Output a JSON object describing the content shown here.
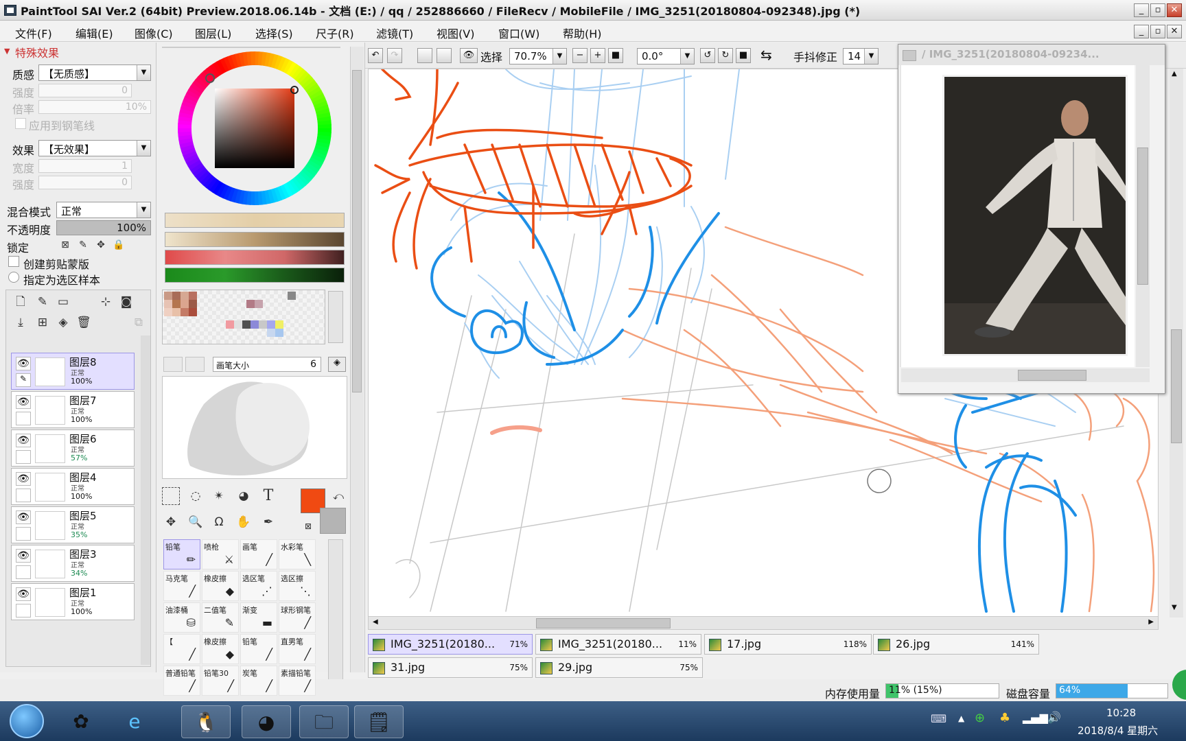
{
  "title": "PaintTool SAI Ver.2 (64bit) Preview.2018.06.14b - 文档 (E:) / qq / 252886660 / FileRecv / MobileFile / IMG_3251(20180804-092348).jpg (*)",
  "menu": [
    "文件(F)",
    "编辑(E)",
    "图像(C)",
    "图层(L)",
    "选择(S)",
    "尺子(R)",
    "滤镜(T)",
    "视图(V)",
    "窗口(W)",
    "帮助(H)"
  ],
  "special_effects": {
    "header": "特殊效果",
    "texture_label": "质感",
    "texture_value": "【无质感】",
    "strength_label": "强度",
    "strength_value": "0",
    "scale_label": "倍率",
    "scale_value": "10%",
    "apply_pen_label": "应用到钢笔线",
    "effect_label": "效果",
    "effect_value": "【无效果】",
    "width_label": "宽度",
    "width_value": "1",
    "strength2_label": "强度",
    "strength2_value": "0"
  },
  "layer_props": {
    "blend_label": "混合模式",
    "blend_value": "正常",
    "opacity_label": "不透明度",
    "opacity_value": "100%",
    "lock_label": "锁定",
    "clip_label": "创建剪贴蒙版",
    "sample_label": "指定为选区样本"
  },
  "layers": [
    {
      "name": "图层8",
      "mode": "正常",
      "opacity": "100%",
      "active": true
    },
    {
      "name": "图层7",
      "mode": "正常",
      "opacity": "100%",
      "active": false
    },
    {
      "name": "图层6",
      "mode": "正常",
      "opacity": "57%",
      "active": false
    },
    {
      "name": "图层4",
      "mode": "正常",
      "opacity": "100%",
      "active": false
    },
    {
      "name": "图层5",
      "mode": "正常",
      "opacity": "35%",
      "active": false
    },
    {
      "name": "图层3",
      "mode": "正常",
      "opacity": "34%",
      "active": false
    },
    {
      "name": "图层1",
      "mode": "正常",
      "opacity": "100%",
      "active": false
    }
  ],
  "brush": {
    "size_label": "画笔大小",
    "size_value": "6"
  },
  "colors": {
    "primary": "#f04a12",
    "secondary": "#b4b4b4",
    "accent": "#9c95e6"
  },
  "tools": [
    {
      "name": "铅笔",
      "icon": "pencil-icon",
      "active": true
    },
    {
      "name": "喷枪",
      "icon": "airbrush-icon",
      "active": false
    },
    {
      "name": "画笔",
      "icon": "brush-icon",
      "active": false
    },
    {
      "name": "水彩笔",
      "icon": "watercolor-icon",
      "active": false
    },
    {
      "name": "马克笔",
      "icon": "marker-icon",
      "active": false
    },
    {
      "name": "橡皮擦",
      "icon": "eraser-icon",
      "active": false
    },
    {
      "name": "选区笔",
      "icon": "selpen-icon",
      "active": false
    },
    {
      "name": "选区擦",
      "icon": "selerase-icon",
      "active": false
    },
    {
      "name": "油漆桶",
      "icon": "bucket-icon",
      "active": false
    },
    {
      "name": "二值笔",
      "icon": "binary-pen-icon",
      "active": false
    },
    {
      "name": "渐变",
      "icon": "gradient-icon",
      "active": false
    },
    {
      "name": "球形钢笔",
      "icon": "ball-pen-icon",
      "active": false
    },
    {
      "name": "【",
      "icon": "bracket-icon",
      "active": false
    },
    {
      "name": "橡皮擦",
      "icon": "eraser2-icon",
      "active": false
    },
    {
      "name": "铅笔",
      "icon": "pencil2-icon",
      "active": false
    },
    {
      "name": "直男笔",
      "icon": "pen3-icon",
      "active": false
    },
    {
      "name": "普通铅笔",
      "icon": "pencil3-icon",
      "active": false
    },
    {
      "name": "铅笔30",
      "icon": "pencil4-icon",
      "active": false
    },
    {
      "name": "炭笔",
      "icon": "charcoal-icon",
      "active": false
    },
    {
      "name": "素描铅笔",
      "icon": "sketch-icon",
      "active": false
    }
  ],
  "view_toolbar": {
    "select_label": "选择",
    "zoom": "70.7%",
    "rotation": "0.0°",
    "stabilizer_label": "手抖修正",
    "stabilizer_value": "14"
  },
  "navigator": {
    "title": "/ IMG_3251(20180804-09234..."
  },
  "doc_tabs": [
    {
      "name": "IMG_3251(20180...",
      "zoom": "71%",
      "active": true
    },
    {
      "name": "IMG_3251(20180...",
      "zoom": "11%",
      "active": false
    },
    {
      "name": "17.jpg",
      "zoom": "118%",
      "active": false
    },
    {
      "name": "26.jpg",
      "zoom": "141%",
      "active": false
    },
    {
      "name": "31.jpg",
      "zoom": "75%",
      "active": false
    },
    {
      "name": "29.jpg",
      "zoom": "75%",
      "active": false
    }
  ],
  "status": {
    "memory_label": "内存使用量",
    "memory_value": "11% (15%)",
    "memory_fraction": 0.11,
    "disk_label": "磁盘容量",
    "disk_value": "64%",
    "disk_fraction": 0.64
  },
  "taskbar": {
    "time": "10:28",
    "date": "2018/8/4 星期六"
  }
}
